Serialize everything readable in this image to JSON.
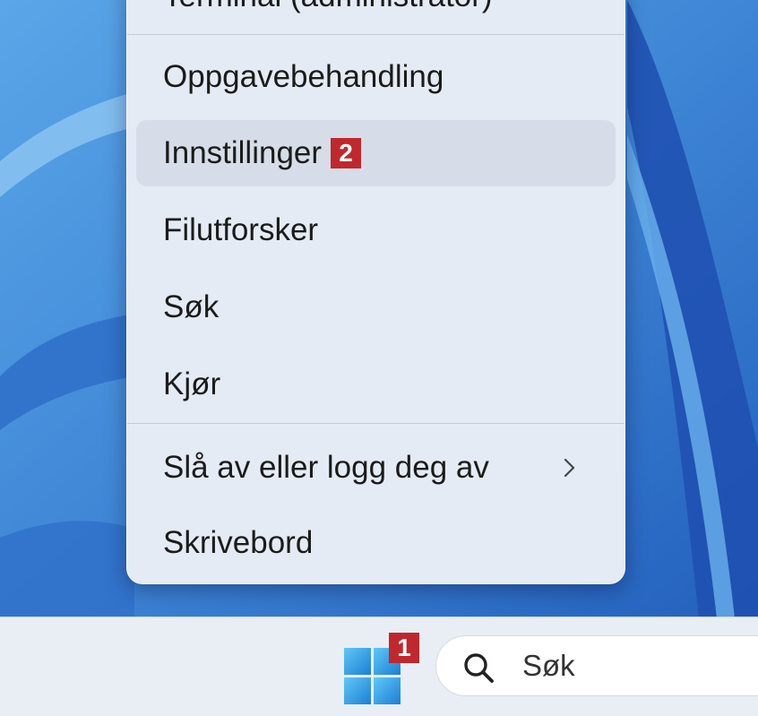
{
  "context_menu": {
    "items": [
      {
        "label": "Terminal (administrator)"
      },
      {
        "label": "Oppgavebehandling"
      },
      {
        "label": "Innstillinger",
        "badge": "2"
      },
      {
        "label": "Filutforsker"
      },
      {
        "label": "Søk"
      },
      {
        "label": "Kjør"
      },
      {
        "label": "Slå av eller logg deg av"
      },
      {
        "label": "Skrivebord"
      }
    ]
  },
  "taskbar": {
    "start_badge": "1",
    "search_label": "Søk"
  },
  "colors": {
    "accent_badge": "#c0282d",
    "menu_bg": "#e4ebf5",
    "wallpaper": "#3f86d6"
  }
}
